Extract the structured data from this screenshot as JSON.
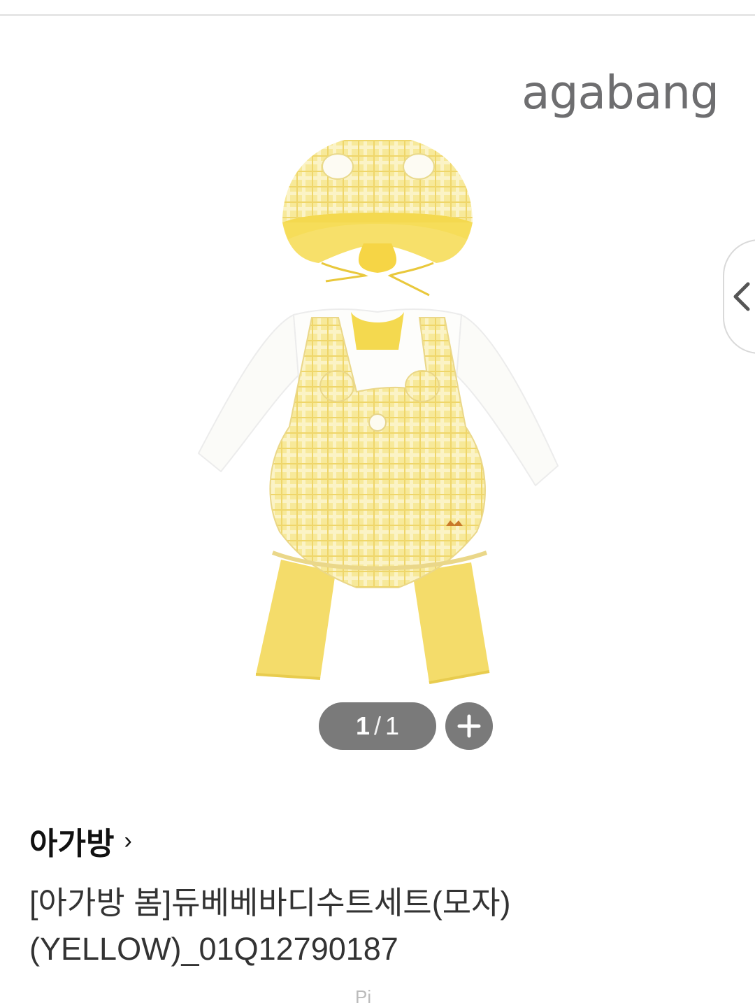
{
  "gallery": {
    "brand_logo_text": "agabang",
    "pager": {
      "current": "1",
      "separator": "/",
      "total": "1"
    },
    "zoom_icon": "plus-icon",
    "prev_icon": "chevron-left-icon"
  },
  "product": {
    "brand": "아가방",
    "brand_chevron": "›",
    "title_line1": "[아가방 봄]듀베베바디수트세트(모자)",
    "title_line2": "(YELLOW)_01Q12790187",
    "partial_text": "Pi"
  },
  "colors": {
    "accent_yellow": "#f3df7a",
    "pager_bg": "#7a7a7a"
  }
}
